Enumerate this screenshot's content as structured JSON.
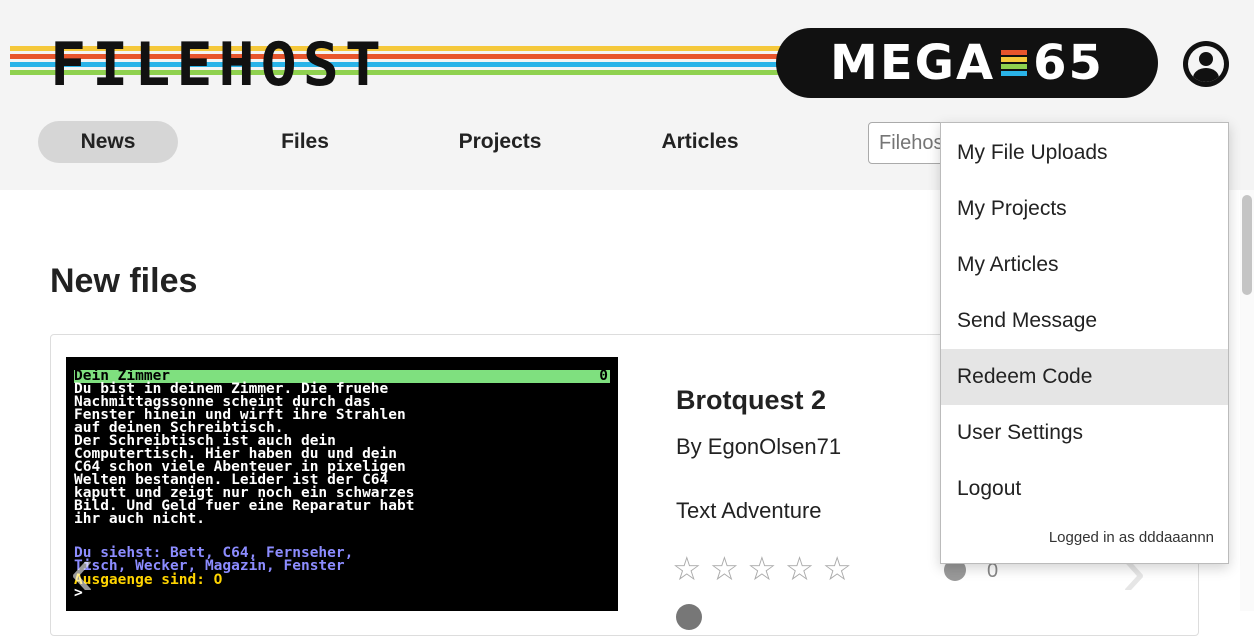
{
  "brand": {
    "logo_text": "FILEHOST",
    "mega_text_left": "MEGA",
    "mega_text_right": "65",
    "stripe_colors": [
      "#f5c83a",
      "#e8552c",
      "#2ab3e8",
      "#8fd14f"
    ]
  },
  "nav": {
    "items": [
      {
        "label": "News",
        "active": true
      },
      {
        "label": "Files"
      },
      {
        "label": "Projects"
      },
      {
        "label": "Articles"
      }
    ],
    "search_placeholder": "Filehost"
  },
  "main": {
    "section_title": "New files"
  },
  "file_card": {
    "title": "Brotquest 2",
    "author": "By EgonOlsen71",
    "genre": "Text Adventure",
    "rating_stars": "☆☆☆☆☆",
    "comment_count": "0",
    "screen": {
      "bar_left": "Dein Zimmer",
      "bar_right": "0",
      "text": "Du bist in deinem Zimmer. Die fruehe\nNachmittagssonne scheint durch das\nFenster hinein und wirft ihre Strahlen\nauf deinen Schreibtisch.\nDer Schreibtisch ist auch dein\nComputertisch. Hier haben du und dein\nC64 schon viele Abenteuer in pixeligen\nWelten bestanden. Leider ist der C64\nkaputt und zeigt nur noch ein schwarzes\nBild. Und Geld fuer eine Reparatur habt\nihr auch nicht.",
      "list": "Du siehst: Bett, C64, Fernseher,\nTisch, Wecker, Magazin, Fenster",
      "exits": "Ausgaenge sind: O",
      "prompt": ">"
    }
  },
  "user_menu": {
    "items": [
      {
        "label": "My File Uploads"
      },
      {
        "label": "My Projects"
      },
      {
        "label": "My Articles"
      },
      {
        "label": "Send Message"
      },
      {
        "label": "Redeem Code",
        "hovered": true
      },
      {
        "label": "User Settings"
      },
      {
        "label": "Logout"
      }
    ],
    "footer": "Logged in as dddaaannn"
  },
  "icons": {
    "user": "user-circle-icon",
    "prev": "chevron-left-icon",
    "next": "chevron-right-icon",
    "star": "star-outline-icon",
    "comment": "comment-icon",
    "info": "info-icon"
  }
}
